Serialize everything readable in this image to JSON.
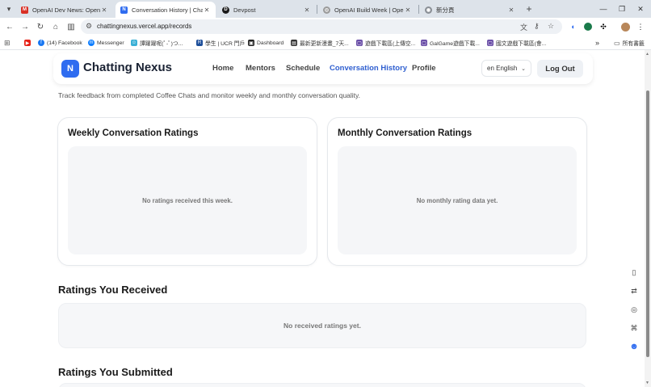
{
  "browser": {
    "tabs": [
      {
        "label": "OpenAI Dev News: OpenAI Bui",
        "icon": "gmail-icon",
        "color": "#d93025",
        "letter": "M"
      },
      {
        "label": "Conversation History | Chatti",
        "icon": "chatting-nexus-favicon",
        "color": "#2f6cf0",
        "letter": "N",
        "active": true
      },
      {
        "label": "Devpost",
        "icon": "devpost-icon",
        "color": "#1a1a1a",
        "letter": "D"
      },
      {
        "label": "OpenAI Build Week | OpenAI",
        "icon": "openai-icon",
        "color": "#555555",
        "letter": "◎"
      },
      {
        "label": "新分頁",
        "icon": "chrome-icon",
        "color": "#5f6368",
        "letter": "◉"
      }
    ],
    "url": "chattingnexus.vercel.app/records",
    "bookmarks": [
      {
        "label": "(14) Facebook",
        "color": "#1877f2",
        "letter": "f"
      },
      {
        "label": "Messenger",
        "color": "#0a7cff",
        "letter": "m"
      },
      {
        "label": "譚躍躍呢(ﾟ-ﾟ)つ...",
        "color": "#3bb0d6",
        "letter": "☺"
      },
      {
        "label": "學生 | UCR 門戶",
        "color": "#1d4e9a",
        "letter": "R"
      },
      {
        "label": "Dashboard",
        "color": "#222222",
        "letter": "▣"
      },
      {
        "label": "最新更新漫畫_7天...",
        "color": "#333333",
        "letter": "▤"
      },
      {
        "label": "遊戲下載區(上傳空...",
        "color": "#6b4fa8",
        "letter": "▢"
      },
      {
        "label": "GalGame遊戲下載...",
        "color": "#6b4fa8",
        "letter": "▢"
      },
      {
        "label": "國文遊戲下載區(會...",
        "color": "#6b4fa8",
        "letter": "▢"
      }
    ],
    "all_bookmarks": "所有書籤"
  },
  "site": {
    "logo_letter": "N",
    "brand": "Chatting Nexus",
    "nav": [
      "Home",
      "Mentors",
      "Schedule",
      "Conversation History",
      "Profile"
    ],
    "active_nav": "Conversation History",
    "language": "en English",
    "logout": "Log Out"
  },
  "page": {
    "subtitle": "Track feedback from completed Coffee Chats and monitor weekly and monthly conversation quality.",
    "weekly": {
      "title": "Weekly Conversation Ratings",
      "empty": "No ratings received this week."
    },
    "monthly": {
      "title": "Monthly Conversation Ratings",
      "empty": "No monthly rating data yet."
    },
    "received": {
      "title": "Ratings You Received",
      "empty": "No received ratings yet."
    },
    "submitted": {
      "title": "Ratings You Submitted"
    }
  },
  "colors": {
    "accent": "#2f6cf0",
    "active_nav": "#2f5fd0"
  }
}
